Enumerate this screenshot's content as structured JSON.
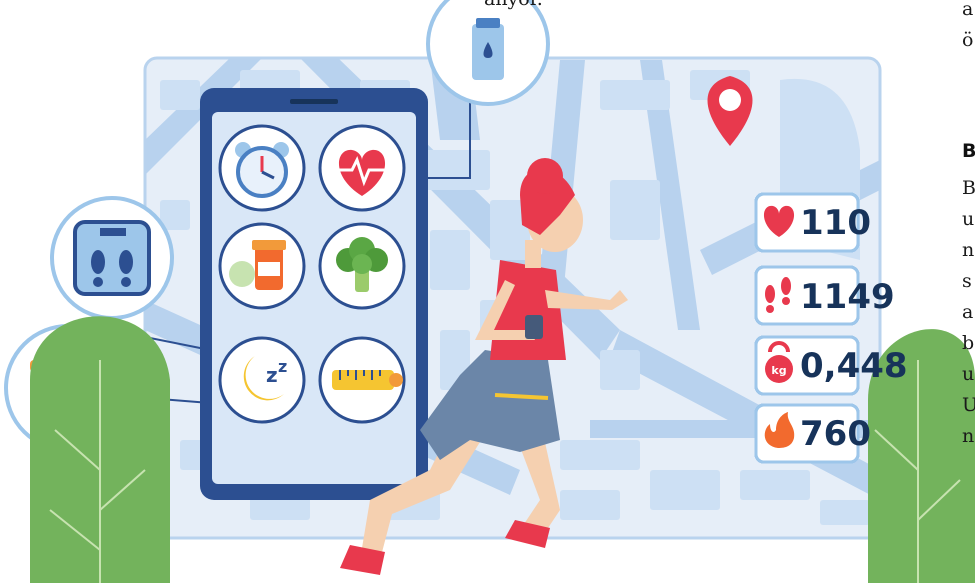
{
  "caption_top": "anyor.",
  "side_column": {
    "top_lines": [
      "a",
      "ö"
    ],
    "heading": "B",
    "body_lines": [
      "B",
      "u",
      "n",
      "s",
      "a",
      "b",
      "u",
      "U",
      "n"
    ]
  },
  "metrics": [
    {
      "icon": "heart-icon",
      "value": "110",
      "color": "#e8394d"
    },
    {
      "icon": "footprints-icon",
      "value": "1149",
      "color": "#e8394d"
    },
    {
      "icon": "kettlebell-kg-icon",
      "value": "0,448",
      "color": "#e8394d"
    },
    {
      "icon": "fire-icon",
      "value": "760",
      "color": "#f26a2e"
    }
  ],
  "weight_unit": "kg",
  "phone_apps": [
    {
      "icon": "alarm-clock-icon"
    },
    {
      "icon": "heart-rate-icon"
    },
    {
      "icon": "pills-icon"
    },
    {
      "icon": "broccoli-icon"
    },
    {
      "icon": "sleep-moon-icon"
    },
    {
      "icon": "measuring-tape-icon"
    }
  ],
  "bubbles": [
    {
      "icon": "water-bottle-icon"
    },
    {
      "icon": "bathroom-scale-icon"
    },
    {
      "icon": "dumbbells-icon"
    }
  ],
  "colors": {
    "map_bg": "#e6eef8",
    "map_road": "#b8d2ee",
    "map_block": "#cde0f4",
    "phone_frame": "#2c4f91",
    "accent_red": "#e8394d",
    "tree_green": "#73b35c"
  }
}
